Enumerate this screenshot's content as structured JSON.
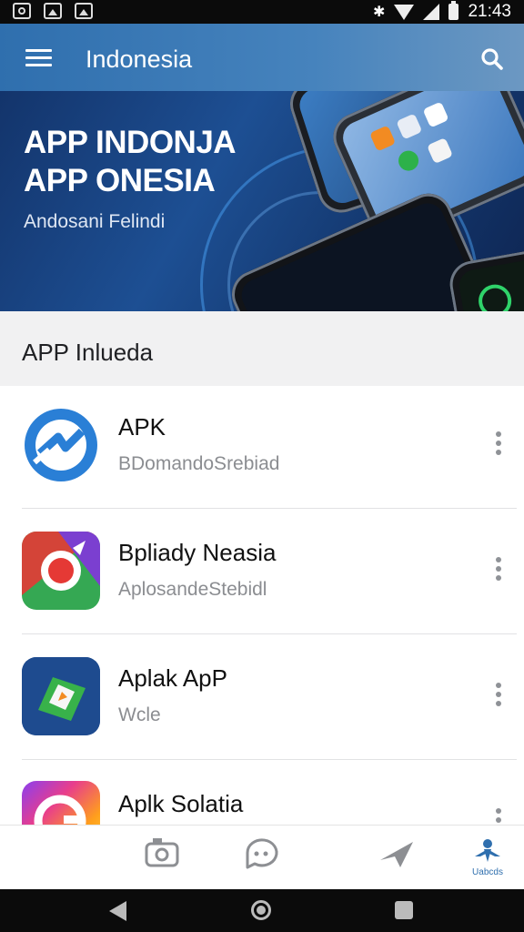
{
  "status_bar": {
    "time": "21:43",
    "bluetooth_glyph": "✱"
  },
  "app_bar": {
    "title": "Indonesia",
    "menu_icon": "hamburger-menu-icon",
    "search_icon": "search-icon"
  },
  "banner": {
    "headline_line1": "APP INDONJA",
    "headline_line2": "APP ONESIA",
    "subtitle": "Andosani Felindi"
  },
  "section": {
    "title": "APP Inlueda"
  },
  "apps": [
    {
      "title": "APK",
      "subtitle": "BDomandoSrebiad",
      "icon": "blue-lightning-app-icon"
    },
    {
      "title": "Bpliady Neasia",
      "subtitle": "AplosandeStebidl",
      "icon": "red-green-app-icon"
    },
    {
      "title": "Aplak ApP",
      "subtitle": "Wcle",
      "icon": "blue-green-app-icon"
    },
    {
      "title": "Aplk Solatia",
      "subtitle": "",
      "icon": "rainbow-app-icon"
    }
  ],
  "bottom_nav": [
    {
      "icon": "camera-icon",
      "label": ""
    },
    {
      "icon": "chat-icon",
      "label": ""
    },
    {
      "icon": "send-icon",
      "label": ""
    },
    {
      "icon": "person-icon",
      "label": "Uabcds"
    }
  ],
  "colors": {
    "accent": "#2f6fae",
    "app_bar": "#3a79b6",
    "banner": "#1d4f93"
  }
}
